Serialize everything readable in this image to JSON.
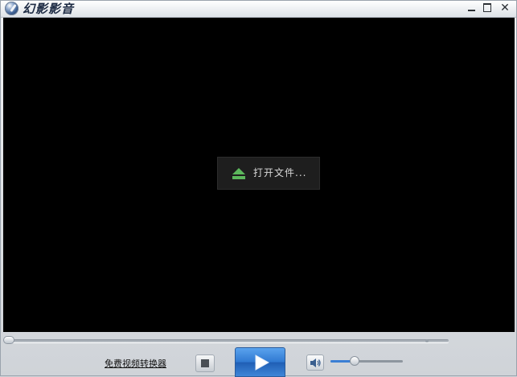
{
  "app": {
    "title": "幻影影音",
    "logo_icon": "app-logo-icon"
  },
  "window_controls": {
    "minimize": "—",
    "maximize": "□",
    "close": "✕"
  },
  "video": {
    "open_file_label": "打开文件...",
    "open_file_icon": "eject-icon",
    "icon_color": "#5cb85c"
  },
  "seek": {
    "progress": 0
  },
  "controls": {
    "converter_link": "免费视频转换器",
    "stop_icon": "stop-icon",
    "play_icon": "play-icon",
    "volume_icon": "speaker-icon",
    "volume_level": 0.33,
    "accent_color": "#2f78d1"
  }
}
